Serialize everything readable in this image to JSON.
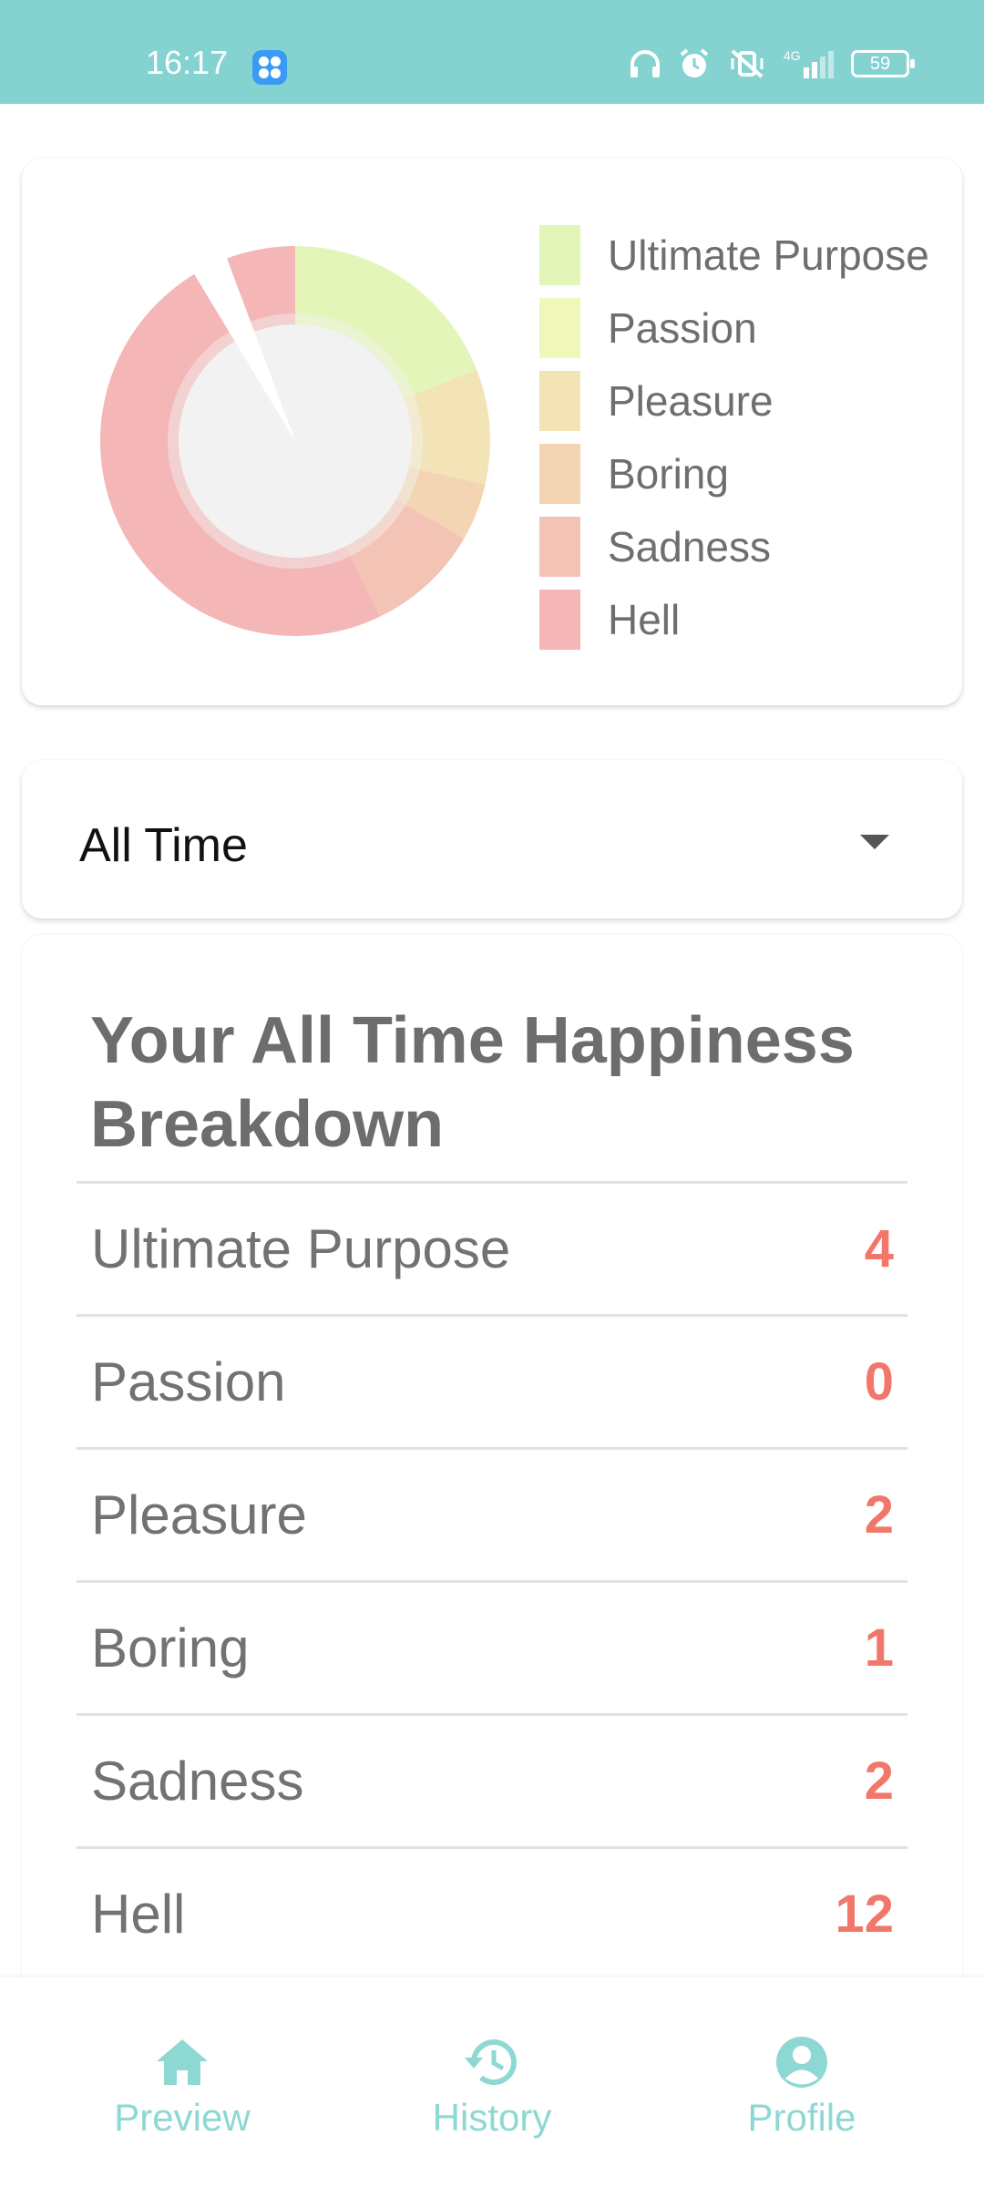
{
  "status_bar": {
    "time": "16:17",
    "battery": "59",
    "background": "#85d3d0"
  },
  "chart_card": {
    "chart_data": {
      "type": "pie",
      "categories": [
        "Ultimate Purpose",
        "Passion",
        "Pleasure",
        "Boring",
        "Sadness",
        "Hell"
      ],
      "values": [
        4,
        0,
        2,
        1,
        2,
        12
      ],
      "colors": [
        "#e3f5b9",
        "#f1f6ba",
        "#f2e4b6",
        "#f3d5b4",
        "#f3c3b5",
        "#f4b6b6"
      ]
    },
    "legend": [
      {
        "label": "Ultimate Purpose",
        "color": "#e3f5b9"
      },
      {
        "label": "Passion",
        "color": "#f1f6ba"
      },
      {
        "label": "Pleasure",
        "color": "#f2e4b6"
      },
      {
        "label": "Boring",
        "color": "#f3d5b4"
      },
      {
        "label": "Sadness",
        "color": "#f3c3b5"
      },
      {
        "label": "Hell",
        "color": "#f4b6b6"
      }
    ]
  },
  "filter": {
    "selected": "All Time",
    "icon": "dropdown-arrow-icon"
  },
  "breakdown": {
    "title": "Your All Time Happiness Breakdown",
    "rows": [
      {
        "name": "Ultimate Purpose",
        "count": "4"
      },
      {
        "name": "Passion",
        "count": "0"
      },
      {
        "name": "Pleasure",
        "count": "2"
      },
      {
        "name": "Boring",
        "count": "1"
      },
      {
        "name": "Sadness",
        "count": "2"
      },
      {
        "name": "Hell",
        "count": "12"
      }
    ],
    "count_color": "#f2776b"
  },
  "bottom_nav": {
    "items": [
      {
        "label": "Preview",
        "icon": "home-icon"
      },
      {
        "label": "History",
        "icon": "history-icon"
      },
      {
        "label": "Profile",
        "icon": "profile-icon"
      }
    ],
    "color": "#8ed8d3"
  }
}
